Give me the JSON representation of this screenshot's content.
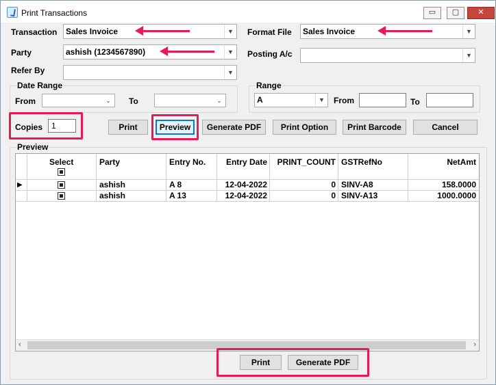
{
  "window": {
    "title": "Print Transactions",
    "controls": {
      "minimize": "▭",
      "maximize": "▢",
      "close": "✕"
    }
  },
  "form": {
    "transaction_label": "Transaction",
    "transaction_value": "Sales Invoice",
    "format_file_label": "Format File",
    "format_file_value": "Sales Invoice",
    "party_label": "Party",
    "party_value": "ashish (1234567890)",
    "posting_label": "Posting A/c",
    "posting_value": "",
    "refer_by_label": "Refer By",
    "refer_by_value": "",
    "date_range_label": "Date Range",
    "from_label": "From",
    "to_label": "To",
    "from_value": "",
    "to_value": "",
    "range_label": "Range",
    "range_value": "A",
    "range_from_label": "From",
    "range_to_label": "To",
    "range_from_value": "",
    "range_to_value": "",
    "copies_label": "Copies",
    "copies_value": "1"
  },
  "toolbar": {
    "print": "Print",
    "preview": "Preview",
    "generate_pdf": "Generate PDF",
    "print_option": "Print Option",
    "print_barcode": "Print Barcode",
    "cancel": "Cancel"
  },
  "preview": {
    "label": "Preview",
    "columns": [
      "Select",
      "Party",
      "Entry No.",
      "Entry Date",
      "PRINT_COUNT",
      "GSTRefNo",
      "NetAmt"
    ],
    "rows": [
      {
        "party": "ashish",
        "entry_no": "A 8",
        "entry_date": "12-04-2022",
        "print_count": "0",
        "gst_ref": "SINV-A8",
        "net_amt": "158.0000"
      },
      {
        "party": "ashish",
        "entry_no": "A 13",
        "entry_date": "12-04-2022",
        "print_count": "0",
        "gst_ref": "SINV-A13",
        "net_amt": "1000.0000"
      }
    ]
  },
  "footer": {
    "print": "Print",
    "generate_pdf": "Generate PDF"
  },
  "icons": {
    "dropdown_arrow": "chevron-down-icon",
    "row_pointer": "row-pointer-icon",
    "scroll_left": "‹",
    "scroll_right": "›"
  },
  "colors": {
    "annotation": "#e8195a",
    "focus": "#0078d7"
  }
}
